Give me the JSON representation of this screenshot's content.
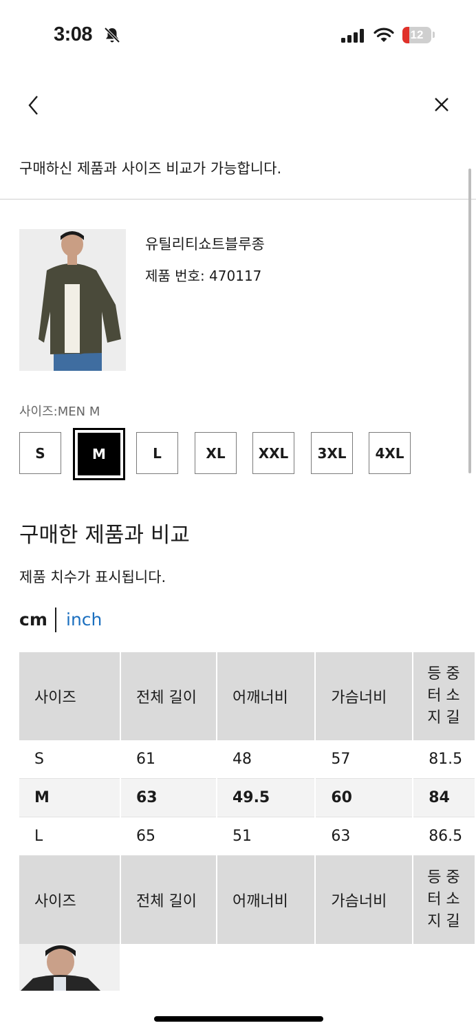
{
  "status_bar": {
    "time": "3:08",
    "battery": "12"
  },
  "header": {
    "intro": "구매하신 제품과 사이즈 비교가 가능합니다."
  },
  "product": {
    "name": "유틸리티쇼트블루종",
    "number": "제품 번호: 470117"
  },
  "size_selector": {
    "label": "사이즈:MEN M",
    "sizes": [
      "S",
      "M",
      "L",
      "XL",
      "XXL",
      "3XL",
      "4XL"
    ],
    "selected": "M"
  },
  "compare": {
    "title": "구매한 제품과 비교",
    "subtitle": "제품 치수가 표시됩니다.",
    "units": {
      "cm": "cm",
      "inch": "inch",
      "selected": "cm"
    }
  },
  "table": {
    "headers": [
      "사이즈",
      "전체 길이",
      "어깨너비",
      "가슴너비",
      "등 중\n터 소\n지 길"
    ],
    "rows": [
      [
        "S",
        "61",
        "48",
        "57",
        "81.5"
      ],
      [
        "M",
        "63",
        "49.5",
        "60",
        "84"
      ],
      [
        "L",
        "65",
        "51",
        "63",
        "86.5"
      ]
    ],
    "selected_row": 1
  },
  "icons": {
    "back": "chevron-left-icon",
    "close": "close-icon"
  }
}
